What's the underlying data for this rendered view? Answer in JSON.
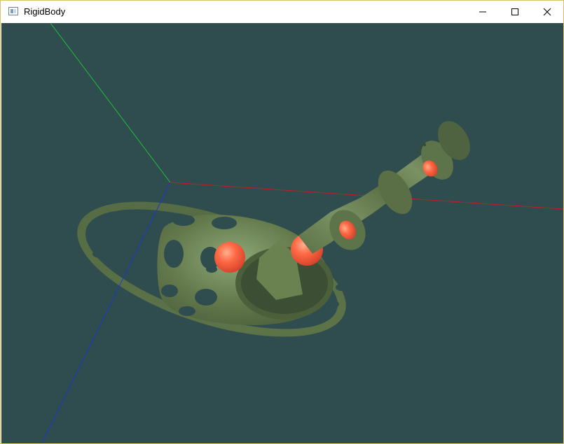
{
  "window": {
    "title": "RigidBody",
    "icon": "app-window-icon",
    "controls": [
      "minimize-icon",
      "maximize-icon",
      "close-icon"
    ]
  },
  "viewport": {
    "background": "#2f4c4e",
    "axes": {
      "x_color": "#c81e1e",
      "y_color": "#22c03a",
      "z_color": "#2038c8"
    },
    "model_color": "#5f7448",
    "sphere_color": "#ff6a45"
  }
}
